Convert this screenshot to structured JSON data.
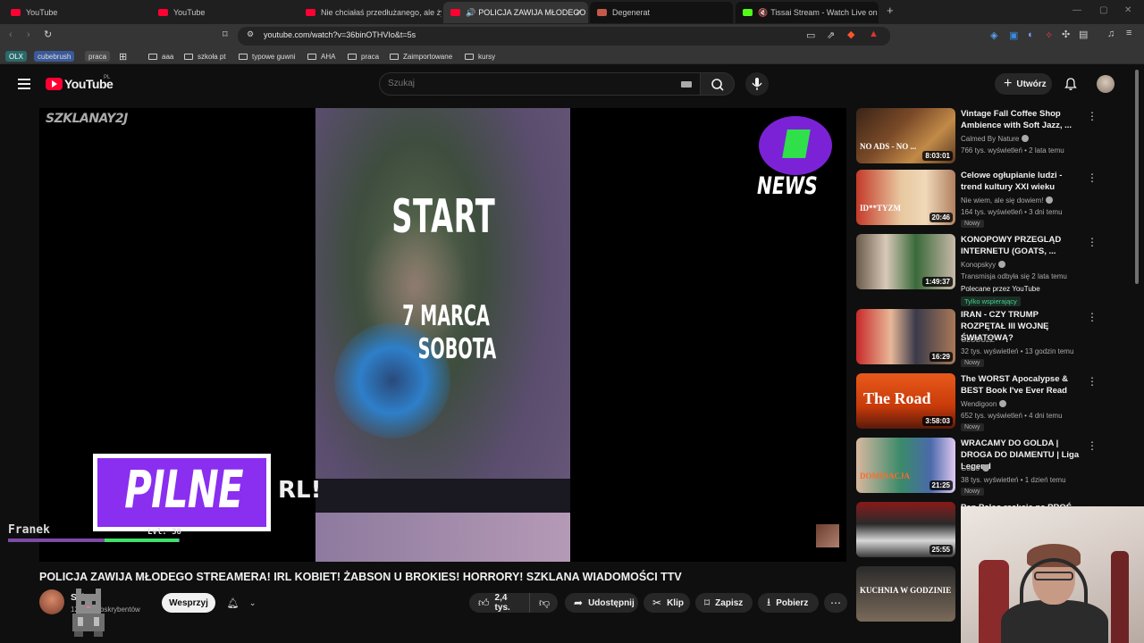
{
  "browser": {
    "tabs": [
      {
        "title": "YouTube",
        "fav": "#ff0033"
      },
      {
        "title": "YouTube",
        "fav": "#ff0033"
      },
      {
        "title": "Nie chciałaś przedłużanego, ale żyć z...",
        "fav": "#ff0033"
      },
      {
        "title": "POLICJA ZAWIJA MŁODEGO ST...",
        "fav": "#ff0033"
      },
      {
        "title": "Degenerat",
        "fav": "#c4584a"
      },
      {
        "title": "Tissai Stream - Watch Live on Kick",
        "fav": "#53fc18"
      }
    ],
    "close_glyph": "✕",
    "new_tab_glyph": "+",
    "url": "youtube.com/watch?v=36binOTHVIo&t=5s",
    "bookmarks_chips": [
      "OLX",
      "cubebrush",
      "praca"
    ],
    "bookmark_folders": [
      "aaa",
      "szkoła pt",
      "typowe guwni",
      "AHA",
      "praca",
      "Zaimportowane",
      "kursy"
    ]
  },
  "youtube": {
    "logo_text": "YouTube",
    "region": "PL",
    "search_placeholder": "Szukaj",
    "create_label": "Utwórz"
  },
  "video": {
    "overlay_start": "START",
    "overlay_date_1": "7 MARCA",
    "overlay_date_2": "SOBOTA",
    "watermark": "SZKLANAY2J",
    "news_label": "NEWS",
    "pilne_label": "PILNE",
    "side_text": "RL!",
    "hud_name": "Franek",
    "hud_level": "Lvl: 38",
    "xp_fraction": 0.43,
    "title": "POLICJA ZAWIJA MŁODEGO STREAMERA! IRL KOBIET! ŻABSON U BROKIES! HORRORY! SZKLANA WIADOMOŚCI TTV",
    "channel_name": "Szk",
    "channel_subs": "124 ... subskrybentów",
    "support_label": "Wesprzyj",
    "like_count": "2,4 tys.",
    "share_label": "Udostępnij",
    "clip_label": "Klip",
    "save_label": "Zapisz",
    "download_label": "Pobierz"
  },
  "sidebar": [
    {
      "title": "Vintage Fall Coffee Shop Ambience with Soft Jazz, ...",
      "channel": "Calmed By Nature",
      "verified": true,
      "meta": "766 tys. wyświetleń • 2 lata temu",
      "duration": "8:03:01",
      "badge": "",
      "thumb": "linear-gradient(135deg,#3a2418,#7a4a28 40%,#c28a48 70%,#5a3a22)",
      "thumb_text": "NO ADS - NO ..."
    },
    {
      "title": "Celowe ogłupianie ludzi - trend kultury XXI wieku",
      "channel": "Nie wiem, ale się dowiem!",
      "verified": true,
      "meta": "164 tys. wyświetleń • 3 dni temu",
      "duration": "20:46",
      "badge": "Nowy",
      "thumb": "linear-gradient(90deg,#c43a2a,#e8c8a0 45%,#f0d8b8 70%,#b08060)",
      "thumb_text": "ID**TYZM"
    },
    {
      "title": "KONOPOWY PRZEGLĄD INTERNETU (GOATS, ...",
      "channel": "Konopskyy",
      "verified": true,
      "meta": "Transmisja odbyła się 2 lata temu",
      "duration": "1:49:37",
      "badge": "",
      "extra": "Polecane przez YouTube",
      "green": "Tylko wspierający",
      "thumb": "linear-gradient(90deg,#6a5a4a,#d8c8b8 30%,#3a6a3a 60%,#c8b8a8)",
      "thumb_text": ""
    },
    {
      "title": "IRAN - CZY TRUMP ROZPĘTAŁ III WOJNĘ ŚWIATOWĄ?",
      "channel": "GLOBUZZ",
      "verified": false,
      "meta": "32 tys. wyświetleń • 13 godzin temu",
      "duration": "16:29",
      "badge": "Nowy",
      "thumb": "linear-gradient(90deg,#c82a2a,#e8b898 35%,#3a3a4a 60%,#a87858)",
      "thumb_text": ""
    },
    {
      "title": "The WORST Apocalypse & BEST Book I've Ever Read",
      "channel": "Wendigoon",
      "verified": true,
      "meta": "652 tys. wyświetleń • 4 dni temu",
      "duration": "3:58:03",
      "badge": "Nowy",
      "thumb": "linear-gradient(180deg,#e85a1a,#c83a0a 60%,#5a1a0a)",
      "thumb_text": "The Road"
    },
    {
      "title": "WRACAMY DO GOLDA | DROGA DO DIAMENTU | Liga Legend",
      "channel": "Gucio",
      "verified": true,
      "meta": "38 tys. wyświetleń • 1 dzień temu",
      "duration": "21:25",
      "badge": "Nowy",
      "thumb": "linear-gradient(90deg,#d8b8a0,#3a8a6a 45%,#4a6aaa 75%,#e0c8f0)",
      "thumb_text": "DOMINACJA"
    },
    {
      "title": "Pan Paleo reakcje na PROŚ...",
      "channel": "",
      "verified": false,
      "meta": "",
      "duration": "25:55",
      "badge": "",
      "thumb": "linear-gradient(180deg,#8a1a1a,#2a2a2a 40%,#d8d8d8 70%,#3a3a3a)",
      "thumb_text": ""
    },
    {
      "title": "",
      "channel": "",
      "verified": false,
      "meta": "",
      "duration": "",
      "badge": "",
      "thumb": "linear-gradient(180deg,#2a2a2a,#7a6a5a)",
      "thumb_text": "KUCHNIA W GODZINIE"
    }
  ]
}
